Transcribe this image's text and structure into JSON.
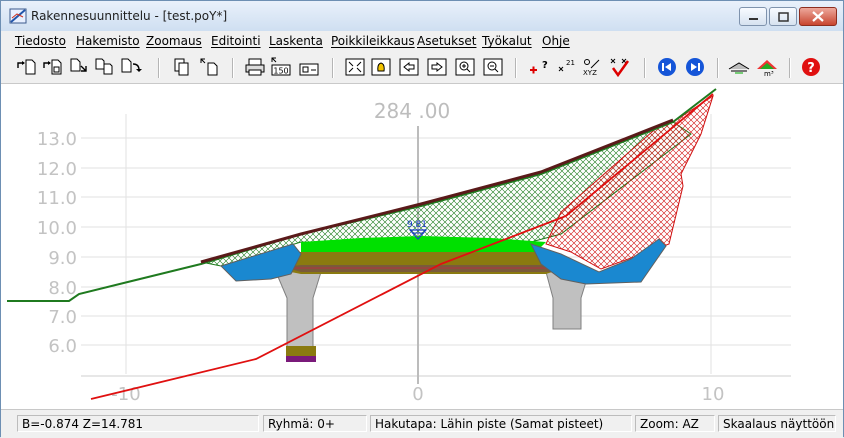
{
  "window": {
    "title": "Rakennesuunnittelu - [test.poY*]"
  },
  "menu": [
    "Tiedosto",
    "Hakemisto",
    "Zoomaus",
    "Editointi",
    "Laskenta",
    "Poikkileikkaus",
    "Asetukset",
    "Työkalut",
    "Ohje"
  ],
  "toolbar": {
    "zoom_label": "150",
    "xyz_label": "XYZ"
  },
  "canvas": {
    "station_label": "284 .00",
    "point_label": "9.81",
    "y_ticks": [
      "13.0",
      "12.0",
      "11.0",
      "10.0",
      "9.0",
      "8.0",
      "7.0",
      "6.0"
    ],
    "x_ticks": [
      "-10",
      "0",
      "10"
    ],
    "colors": {
      "ground_line": "#1f7a1f",
      "design_line": "#e01010",
      "surface_green": "#00e000",
      "water_blue": "#1a88d0",
      "fill_olive": "#8a7a10",
      "culvert_gray": "#c0c0c0"
    }
  },
  "status": {
    "coords": "B=-0.874  Z=14.781",
    "group": "Ryhmä: 0+",
    "search": "Hakutapa: Lähin piste (Samat pisteet)",
    "zoom": "Zoom: AZ",
    "scaling": "Skaalaus näyttöön"
  }
}
